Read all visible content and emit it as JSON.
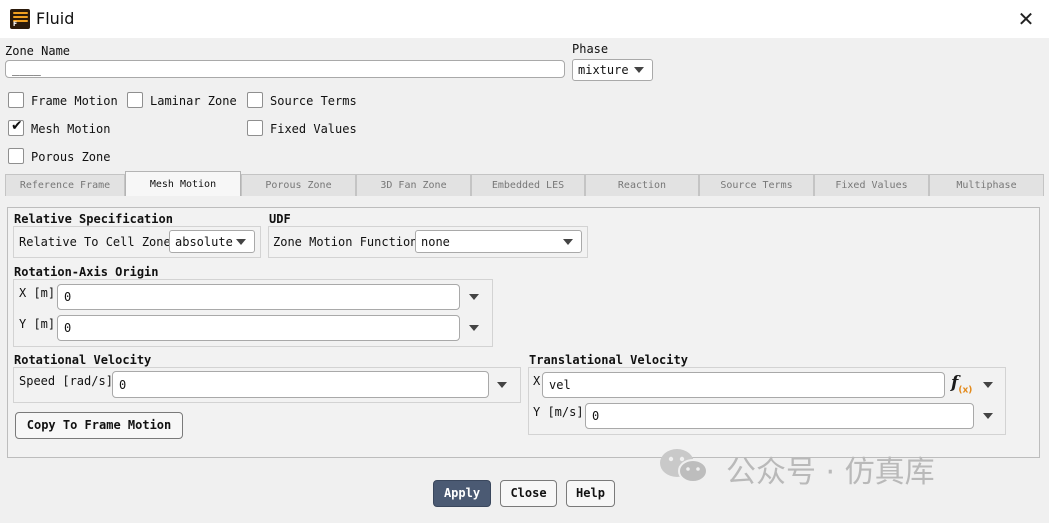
{
  "window": {
    "title": "Fluid",
    "close_glyph": "✕"
  },
  "zone": {
    "name_label": "Zone Name",
    "name_value": "____",
    "phase_label": "Phase",
    "phase_value": "mixture"
  },
  "checkboxes": [
    {
      "label": "Frame Motion",
      "checked": false
    },
    {
      "label": "Laminar Zone",
      "checked": false
    },
    {
      "label": "Source Terms",
      "checked": false
    },
    {
      "label": "Mesh Motion",
      "checked": true
    },
    {
      "label": "Fixed Values",
      "checked": false
    },
    {
      "label": "Porous Zone",
      "checked": false
    }
  ],
  "tabs": [
    {
      "label": "Reference Frame",
      "active": false
    },
    {
      "label": "Mesh Motion",
      "active": true
    },
    {
      "label": "Porous Zone",
      "active": false
    },
    {
      "label": "3D Fan Zone",
      "active": false
    },
    {
      "label": "Embedded LES",
      "active": false
    },
    {
      "label": "Reaction",
      "active": false
    },
    {
      "label": "Source Terms",
      "active": false
    },
    {
      "label": "Fixed Values",
      "active": false
    },
    {
      "label": "Multiphase",
      "active": false
    }
  ],
  "relative_spec": {
    "title": "Relative Specification",
    "label": "Relative To Cell Zone",
    "value": "absolute"
  },
  "udf": {
    "title": "UDF",
    "label": "Zone Motion Function",
    "value": "none"
  },
  "rotation_origin": {
    "title": "Rotation-Axis Origin",
    "x_label": "X [m]",
    "x_value": "0",
    "y_label": "Y [m]",
    "y_value": "0"
  },
  "rotational_velocity": {
    "title": "Rotational Velocity",
    "label": "Speed [rad/s]",
    "value": "0",
    "copy_button": "Copy To Frame Motion"
  },
  "translational_velocity": {
    "title": "Translational Velocity",
    "x_label": "X",
    "x_value": "vel",
    "y_label": "Y [m/s]",
    "y_value": "0",
    "fx_main": "f",
    "fx_sub": "(x)"
  },
  "footer": {
    "apply": "Apply",
    "close": "Close",
    "help": "Help"
  },
  "watermark": {
    "text": "公众号 · 仿真库"
  },
  "colors": {
    "primary_button": "#4b5a73",
    "fx_accent": "#e38a1b"
  }
}
